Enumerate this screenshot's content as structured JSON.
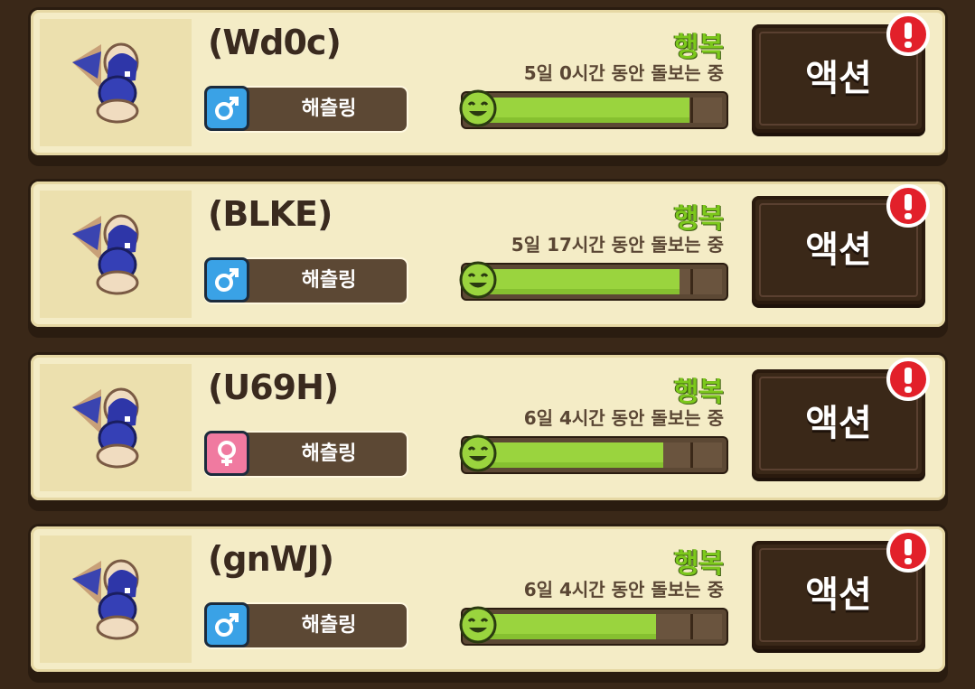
{
  "cards": [
    {
      "name": "(Wd0c)",
      "gender": "male",
      "gender_icon": "male-symbol-icon",
      "species": "해츨링",
      "mood": "행복",
      "care_time": "5일 0시간 동안 돌보는 중",
      "happiness": 0.86,
      "action": "액션"
    },
    {
      "name": "(BLKE)",
      "gender": "male",
      "gender_icon": "male-symbol-icon",
      "species": "해츨링",
      "mood": "행복",
      "care_time": "5일 17시간 동안 돌보는 중",
      "happiness": 0.82,
      "action": "액션"
    },
    {
      "name": "(U69H)",
      "gender": "female",
      "gender_icon": "female-symbol-icon",
      "species": "해츨링",
      "mood": "행복",
      "care_time": "6일 4시간 동안 돌보는 중",
      "happiness": 0.75,
      "action": "액션"
    },
    {
      "name": "(gnWJ)",
      "gender": "male",
      "gender_icon": "male-symbol-icon",
      "species": "해츨링",
      "mood": "행복",
      "care_time": "6일 4시간 동안 돌보는 중",
      "happiness": 0.72,
      "action": "액션"
    }
  ],
  "colors": {
    "happy": "#7cc81c",
    "male": "#3aa2e6",
    "female": "#f07aa0",
    "alert": "#e2202a"
  }
}
